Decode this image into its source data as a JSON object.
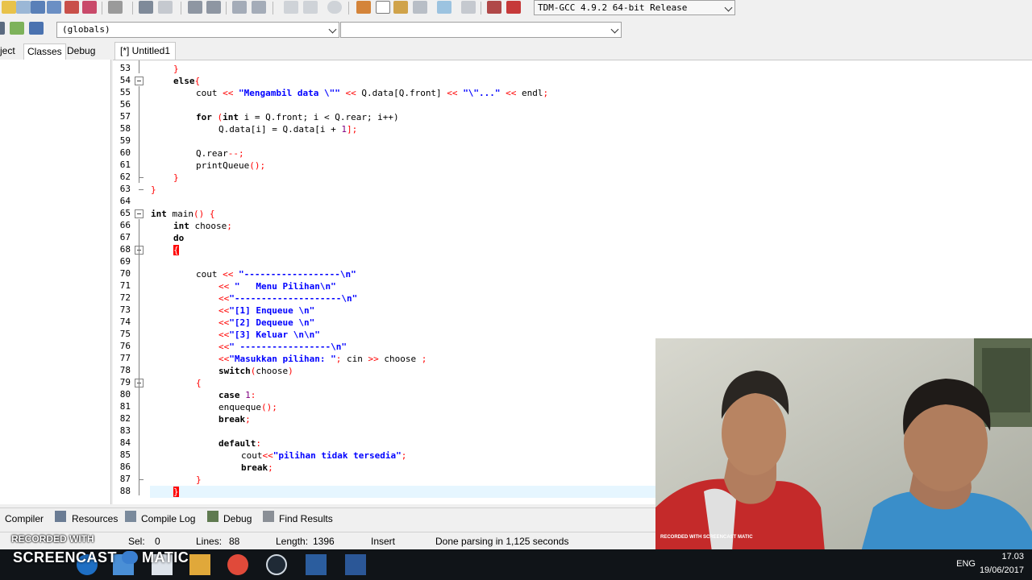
{
  "toolbar": {
    "compiler_select": "TDM-GCC 4.9.2 64-bit Release"
  },
  "scope": {
    "globals": "(globals)"
  },
  "left_tabs": [
    "ject",
    "Classes",
    "Debug"
  ],
  "editor_tab": "[*] Untitled1",
  "line_numbers": [
    "53",
    "54",
    "55",
    "56",
    "57",
    "58",
    "59",
    "60",
    "61",
    "62",
    "63",
    "64",
    "65",
    "66",
    "67",
    "68",
    "69",
    "70",
    "71",
    "72",
    "73",
    "74",
    "75",
    "76",
    "77",
    "78",
    "79",
    "80",
    "81",
    "82",
    "83",
    "84",
    "85",
    "86",
    "87",
    "88"
  ],
  "code": {
    "l53": "}",
    "l54_kw": "else",
    "l54_sym": "{",
    "l55_a": "cout ",
    "l55_b": "<< ",
    "l55_c": "\"Mengambil data \\\"\"",
    "l55_d": " << ",
    "l55_e": "Q.data[Q.front]",
    "l55_f": " << ",
    "l55_g": "\"\\\"...\"",
    "l55_h": " << ",
    "l55_i": "endl",
    "l55_j": ";",
    "l57_kw": "for",
    "l57_a": " (",
    "l57_b": "int",
    "l57_c": " i = Q.front; i < Q.rear; i++)",
    "l58_a": "Q.data[i] = Q.data[i + ",
    "l58_num": "1",
    "l58_b": "];",
    "l60_a": "Q.rear",
    "l60_b": "--;",
    "l61_a": "printQueue",
    "l61_b": "();",
    "l62": "}",
    "l63": "}",
    "l65_kw": "int",
    "l65_a": " main",
    "l65_b": "() {",
    "l66_kw": "int",
    "l66_a": " choose",
    "l66_b": ";",
    "l67_kw": "do",
    "l68": "{",
    "l70_a": "cout ",
    "l70_b": "<< ",
    "l70_c": "\"------------------\\n\"",
    "l71_a": "<< ",
    "l71_b": "\"   Menu Pilihan\\n\"",
    "l72_a": "<<",
    "l72_b": "\"--------------------\\n\"",
    "l73_a": "<<",
    "l73_b": "\"[1] Enqueue \\n\"",
    "l74_a": "<<",
    "l74_b": "\"[2] Dequeue \\n\"",
    "l75_a": "<<",
    "l75_b": "\"[3] Keluar \\n\\n\"",
    "l76_a": "<<",
    "l76_b": "\" -----------------\\n\"",
    "l77_a": "<<",
    "l77_b": "\"Masukkan pilihan: \"",
    "l77_c": "; ",
    "l77_d": "cin ",
    "l77_e": ">> ",
    "l77_f": "choose ",
    "l77_g": ";",
    "l78_kw": "switch",
    "l78_a": "(",
    "l78_b": "choose",
    "l78_c": ")",
    "l79": "{",
    "l80_kw": "case",
    "l80_num": " 1",
    "l80_a": ":",
    "l81_a": "enqueque",
    "l81_b": "();",
    "l82_kw": "break",
    "l82_a": ";",
    "l84_kw": "default",
    "l84_a": ":",
    "l85_a": "cout",
    "l85_b": "<<",
    "l85_c": "\"pilihan tidak tersedia\"",
    "l85_d": ";",
    "l86_kw": "break",
    "l86_a": ";",
    "l87": "}",
    "l88": "}"
  },
  "bottom_tabs": [
    "Compiler",
    "Resources",
    "Compile Log",
    "Debug",
    "Find Results"
  ],
  "status": {
    "recorded": "RECORDED WITH",
    "sel_label": "Sel:",
    "sel_value": "0",
    "lines_label": "Lines:",
    "lines_value": "88",
    "length_label": "Length:",
    "length_value": "1396",
    "mode": "Insert",
    "message": "Done parsing in 1,125 seconds"
  },
  "taskbar": {
    "brand": "SCREENCAST",
    "brand2": "MATIC",
    "lang": "ENG",
    "time": "17.03",
    "date": "19/06/2017"
  },
  "webcam": {
    "label": "RECORDED WITH SCREENCAST MATIC"
  },
  "colors": {
    "keyword": "#000000",
    "string": "#0000ff",
    "symbol": "#ff0000",
    "number": "#800080",
    "current_line": "#e6f6ff"
  }
}
